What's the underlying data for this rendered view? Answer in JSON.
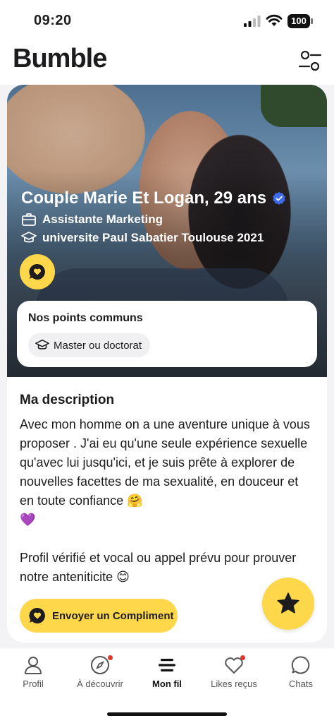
{
  "status_bar": {
    "time": "09:20",
    "battery": "100"
  },
  "header": {
    "logo": "Bumble",
    "filter_icon": "filter-sliders-icon"
  },
  "profile": {
    "name": "Couple Marie Et Logan, 29 ans",
    "verified_icon": "verified-badge-icon",
    "job": "Assistante Marketing",
    "school": "universite Paul Sabatier Toulouse 2021"
  },
  "common": {
    "title": "Nos points communs",
    "chip": "Master ou doctorat"
  },
  "description": {
    "title": "Ma description",
    "text": "Avec mon homme on a une aventure unique à vous proposer . J'ai eu qu'une seule expérience sexuelle qu'avec lui jusqu'ici, et je suis prête à explorer de nouvelles facettes de ma sexualité, en douceur et en toute confiance 🤗\n💜\n\nProfil vérifié et vocal ou appel prévu pour prouver notre anteniticite 😊"
  },
  "actions": {
    "send_compliment": "Envoyer un Compliment"
  },
  "tabs": [
    {
      "label": "Profil",
      "icon": "person-icon"
    },
    {
      "label": "À découvrir",
      "icon": "compass-icon"
    },
    {
      "label": "Mon fil",
      "icon": "feed-icon"
    },
    {
      "label": "Likes reçus",
      "icon": "heart-icon"
    },
    {
      "label": "Chats",
      "icon": "chat-bubble-icon"
    }
  ],
  "colors": {
    "accent": "#ffd74a",
    "verified": "#3e6ae8",
    "notification": "#e0392b"
  }
}
